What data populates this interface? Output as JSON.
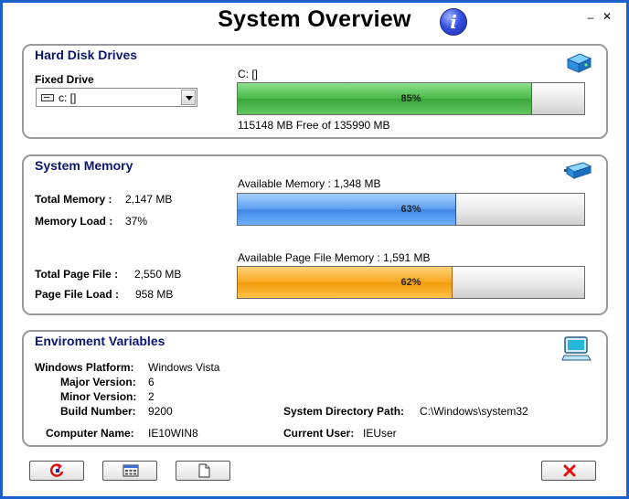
{
  "window": {
    "title": "System Overview",
    "minimize": "_",
    "close": "✕"
  },
  "colors": {
    "background": "#1a62c9",
    "group_title": "#0c1673",
    "disk_fill": "#46b846",
    "memory_fill": "#5c9ef0",
    "pagefile_fill": "#f7a71d"
  },
  "hard_disk": {
    "title": "Hard Disk Drives",
    "fixed_drive_label": "Fixed Drive",
    "selected_drive": "c: []",
    "drive_caption": "C: []",
    "usage_percent": 85,
    "usage_text": "85%",
    "free_text": "115148 MB Free of 135990 MB"
  },
  "memory": {
    "title": "System Memory",
    "total_memory_label": "Total Memory :",
    "total_memory_value": "2,147  MB",
    "memory_load_label": "Memory Load :",
    "memory_load_value": "37%",
    "available_memory_caption": "Available Memory :  1,348  MB",
    "available_memory_percent": 63,
    "available_memory_text": "63%",
    "total_page_file_label": "Total Page File :",
    "total_page_file_value": "2,550  MB",
    "page_file_load_label": "Page File Load :",
    "page_file_load_value": "958  MB",
    "available_page_caption": "Available Page File Memory : 1,591  MB",
    "available_page_percent": 62,
    "available_page_text": "62%"
  },
  "environment": {
    "title": "Enviroment Variables",
    "platform_label": "Windows Platform:",
    "platform_value": "Windows Vista",
    "major_label": "Major Version:",
    "major_value": "6",
    "minor_label": "Minor Version:",
    "minor_value": "2",
    "build_label": "Build Number:",
    "build_value": "9200",
    "computer_label": "Computer Name:",
    "computer_value": "IE10WIN8",
    "sysdir_label": "System Directory Path:",
    "sysdir_value": "C:\\Windows\\system32",
    "user_label": "Current User:",
    "user_value": "IEUser"
  },
  "icons": {
    "info": "info-icon",
    "disk": "hard-disk-icon",
    "memory": "memory-chip-icon",
    "environment": "computer-monitor-icon",
    "refresh": "refresh-icon",
    "calculator": "calculator-icon",
    "document": "document-icon",
    "exit": "close-x-icon"
  }
}
